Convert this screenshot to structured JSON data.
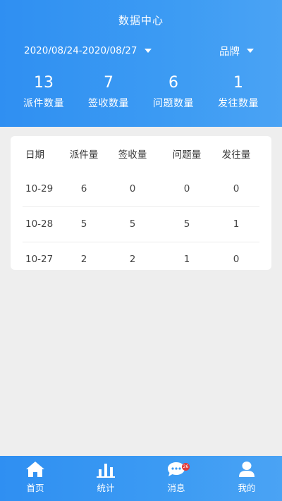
{
  "header": {
    "title": "数据中心",
    "date_range": "2020/08/24-2020/08/27",
    "brand_label": "品牌"
  },
  "stats": [
    {
      "value": "13",
      "label": "派件数量"
    },
    {
      "value": "7",
      "label": "签收数量"
    },
    {
      "value": "6",
      "label": "问题数量"
    },
    {
      "value": "1",
      "label": "发往数量"
    }
  ],
  "table": {
    "columns": [
      "日期",
      "派件量",
      "签收量",
      "问题量",
      "发往量"
    ],
    "rows": [
      [
        "10-29",
        "6",
        "0",
        "0",
        "0"
      ],
      [
        "10-28",
        "5",
        "5",
        "5",
        "1"
      ],
      [
        "10-27",
        "2",
        "2",
        "1",
        "0"
      ]
    ]
  },
  "tabbar": {
    "items": [
      {
        "label": "首页",
        "icon": "home-icon"
      },
      {
        "label": "统计",
        "icon": "bar-chart-icon"
      },
      {
        "label": "消息",
        "icon": "chat-bubble-icon",
        "badge": "26"
      },
      {
        "label": "我的",
        "icon": "user-icon"
      }
    ]
  },
  "colors": {
    "primary": "#3c9bf3",
    "background": "#eeeeee",
    "badge": "#e23b3b"
  }
}
